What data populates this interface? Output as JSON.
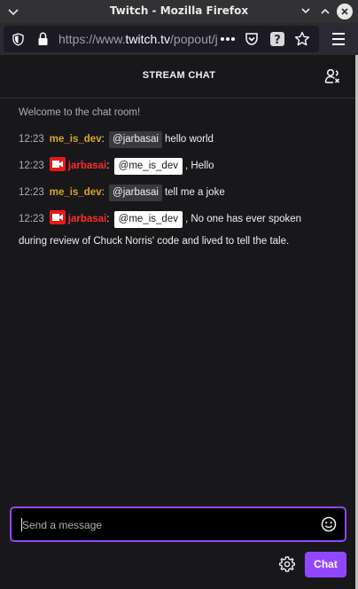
{
  "window": {
    "title": "Twitch - Mozilla Firefox"
  },
  "browser": {
    "url_prefix": "https://www.",
    "url_host": "twitch.tv",
    "url_suffix": "/popout/ja"
  },
  "chat": {
    "title": "STREAM CHAT",
    "welcome": "Welcome to the chat room!",
    "messages": [
      {
        "time": "12:23",
        "user": "me_is_dev",
        "mention": "@jarbasai",
        "text": "hello world"
      },
      {
        "time": "12:23",
        "user": "jarbasai",
        "mention": "@me_is_dev",
        "text": ", Hello"
      },
      {
        "time": "12:23",
        "user": "me_is_dev",
        "mention": "@jarbasai",
        "text": "tell me a joke"
      },
      {
        "time": "12:23",
        "user": "jarbasai",
        "mention": "@me_is_dev",
        "text": ", No one has ever spoken",
        "text_cont": "during review of Chuck Norris' code and lived to tell the tale."
      }
    ],
    "colon": ":",
    "input_placeholder": "Send a message",
    "send_label": "Chat"
  },
  "colors": {
    "accent": "#9147ff",
    "user_me": "#daa520",
    "user_jarbasai": "#ff2a2a"
  },
  "icons": {
    "window_menu": "chevron-down-icon",
    "minimize": "minimize-icon",
    "maximize": "maximize-icon",
    "close": "close-icon",
    "shield": "shield-icon",
    "lock": "lock-icon",
    "more": "more-horizontal-icon",
    "pocket": "pocket-icon",
    "help": "help-icon",
    "bookmark": "star-icon",
    "menu": "hamburger-icon",
    "users": "users-icon",
    "emoji": "emoji-icon",
    "settings": "gear-icon",
    "broadcaster": "camera-badge-icon"
  }
}
